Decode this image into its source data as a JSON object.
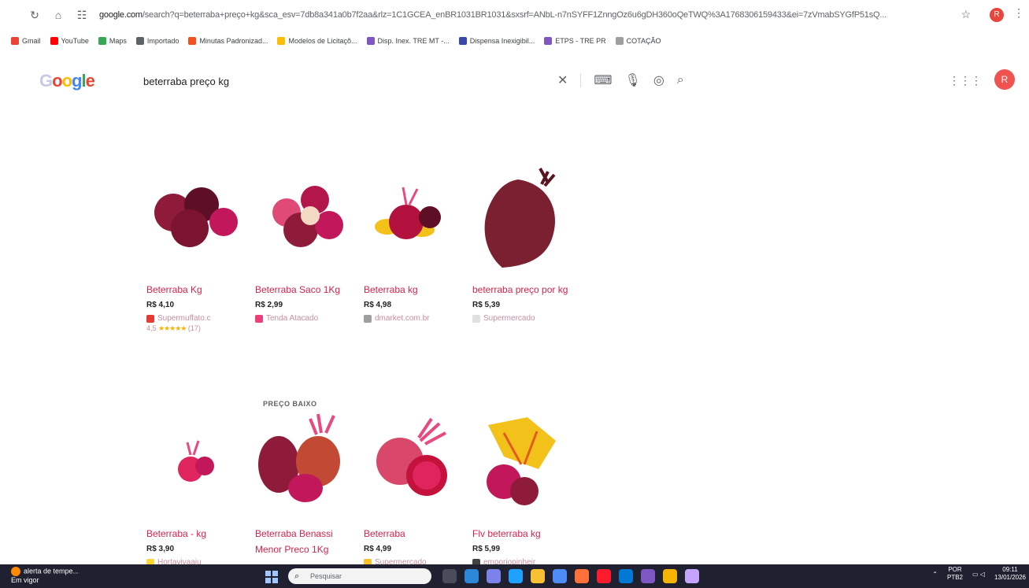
{
  "browser": {
    "url_host": "google.com",
    "url_rest": "/search?q=beterraba+preço+kg&sca_esv=7db8a341a0b7f2aa&rlz=1C1GCEA_enBR1031BR1031&sxsrf=ANbL-n7nSYFF1ZnngOz6u6gDH360oQeTWQ%3A1768306159433&ei=7zVmabSYGfP51sQ...",
    "profile_initial": "R",
    "bookmarks": [
      {
        "label": "Gmail",
        "color": "#ea4335"
      },
      {
        "label": "YouTube",
        "color": "#ff0000"
      },
      {
        "label": "Maps",
        "color": "#34a853"
      },
      {
        "label": "Importado",
        "color": "#5f6368"
      },
      {
        "label": "Minutas Padronizad...",
        "color": "#f4511e"
      },
      {
        "label": "Modelos de Licitaçõ...",
        "color": "#fbbc05"
      },
      {
        "label": "Disp. Inex. TRE MT -...",
        "color": "#7e57c2"
      },
      {
        "label": "Dispensa Inexigibil...",
        "color": "#3949ab"
      },
      {
        "label": "ETPS - TRE PR",
        "color": "#7e57c2"
      },
      {
        "label": "COTAÇÃO",
        "color": "#9e9e9e"
      }
    ]
  },
  "google": {
    "logo_letters": [
      "G",
      "o",
      "o",
      "g",
      "l",
      "e"
    ],
    "query": "beterraba preço kg",
    "avatar_initial": "R"
  },
  "products": [
    {
      "title": "Beterraba Kg",
      "price": "R$ 4,10",
      "seller": "Supermuffato.c",
      "seller_color": "#e53935",
      "rating": "4,5",
      "stars": "★★★★★",
      "reviews": "(17)",
      "badge": "",
      "img": "beets-pile"
    },
    {
      "title": "Beterraba Saco 1Kg",
      "price": "R$ 2,99",
      "seller": "Tenda Atacado",
      "seller_color": "#ec407a",
      "badge": "",
      "img": "beets-bag"
    },
    {
      "title": "Beterraba kg",
      "price": "R$ 4,98",
      "seller": "dmarket.com.br",
      "seller_color": "#9e9e9e",
      "badge": "",
      "img": "beets-leaves"
    },
    {
      "title": "beterraba preço por kg",
      "price": "R$ 5,39",
      "seller": "Supermercado",
      "seller_color": "#e0e0e0",
      "badge": "",
      "img": "beet-big"
    },
    {
      "title": "Beterraba - kg",
      "price": "R$ 3,90",
      "seller": "Hortavivaaju",
      "seller_color": "#fdd835",
      "badge": "",
      "img": "beet-small"
    },
    {
      "title": "Beterraba Benassi Menor Preco 1Kg",
      "price": "",
      "seller": "",
      "seller_color": "",
      "badge": "PREÇO BAIXO",
      "img": "beet-cut"
    },
    {
      "title": "Beterraba",
      "price": "R$ 4,99",
      "seller": "Supermercado",
      "seller_color": "#fbc02d",
      "badge": "",
      "img": "beet-half"
    },
    {
      "title": "Flv beterraba kg",
      "price": "R$ 5,99",
      "seller": "emporiopinheir",
      "seller_color": "#424242",
      "badge": "",
      "img": "beet-yellow-leaves"
    }
  ],
  "taskbar": {
    "alert_title": "alerta de tempe...",
    "alert_sub": "Em vigor",
    "search_placeholder": "Pesquisar",
    "lang": "POR",
    "layout": "PTB2",
    "time": "09:11",
    "date": "13/01/2026"
  }
}
